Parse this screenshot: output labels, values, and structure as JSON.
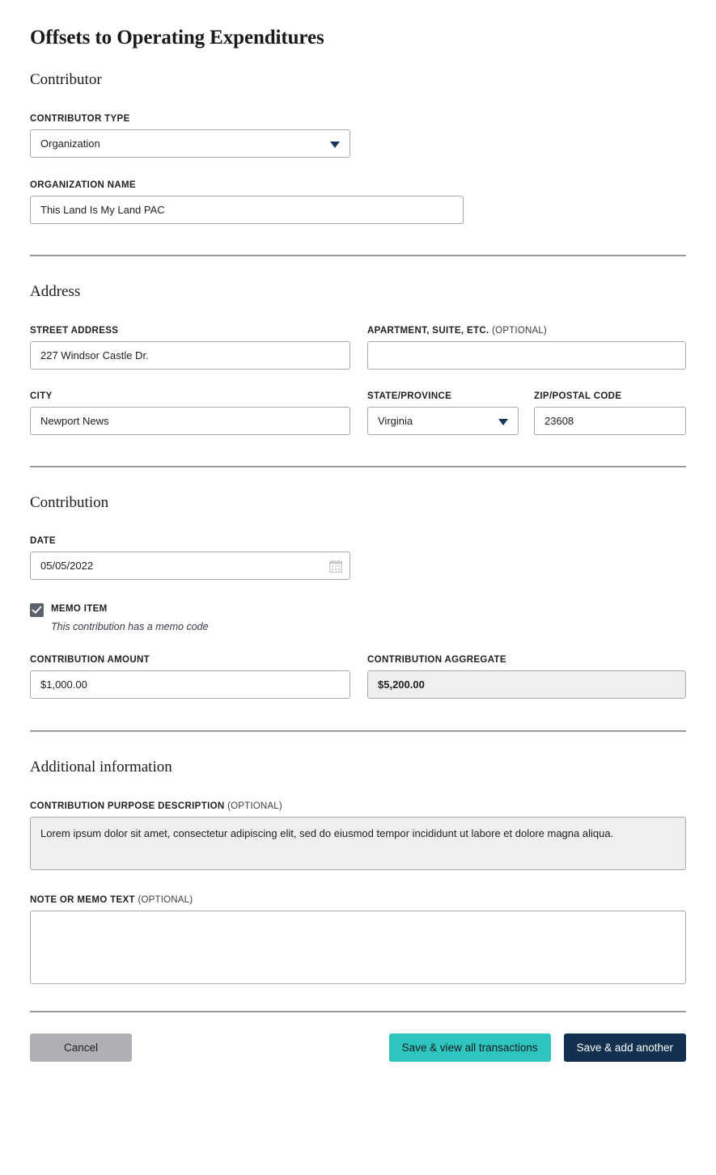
{
  "page": {
    "title": "Offsets to Operating Expenditures"
  },
  "contributor": {
    "heading": "Contributor",
    "type_label": "CONTRIBUTOR TYPE",
    "type_value": "Organization",
    "org_label": "ORGANIZATION NAME",
    "org_value": "This Land Is My Land PAC"
  },
  "address": {
    "heading": "Address",
    "street_label": "STREET ADDRESS",
    "street_value": "227 Windsor Castle Dr.",
    "apt_label": "APARTMENT, SUITE, ETC.",
    "apt_optional": "(OPTIONAL)",
    "apt_value": "",
    "city_label": "CITY",
    "city_value": "Newport News",
    "state_label": "STATE/PROVINCE",
    "state_value": "Virginia",
    "zip_label": "ZIP/POSTAL CODE",
    "zip_value": "23608"
  },
  "contribution": {
    "heading": "Contribution",
    "date_label": "DATE",
    "date_value": "05/05/2022",
    "calendar_icon": "calendar-icon",
    "memo_label": "MEMO ITEM",
    "memo_help": "This contribution has a memo code",
    "memo_checked": true,
    "amount_label": "CONTRIBUTION AMOUNT",
    "amount_value": "$1,000.00",
    "aggregate_label": "CONTRIBUTION AGGREGATE",
    "aggregate_value": "$5,200.00"
  },
  "additional": {
    "heading": "Additional information",
    "purpose_label": "CONTRIBUTION PURPOSE DESCRIPTION",
    "purpose_optional": "(OPTIONAL)",
    "purpose_value": "Lorem ipsum dolor sit amet, consectetur adipiscing elit, sed do eiusmod tempor incididunt ut labore et dolore magna aliqua.",
    "note_label": "NOTE OR MEMO TEXT",
    "note_optional": "(OPTIONAL)",
    "note_value": ""
  },
  "actions": {
    "cancel": "Cancel",
    "save_view": "Save & view all transactions",
    "save_add": "Save & add another"
  },
  "colors": {
    "teal": "#2ec4c0",
    "navy": "#12304f",
    "gray": "#aeb0b5",
    "border": "#a6a8ab",
    "disabled_bg": "#efefef",
    "checkbox": "#5b616b"
  }
}
